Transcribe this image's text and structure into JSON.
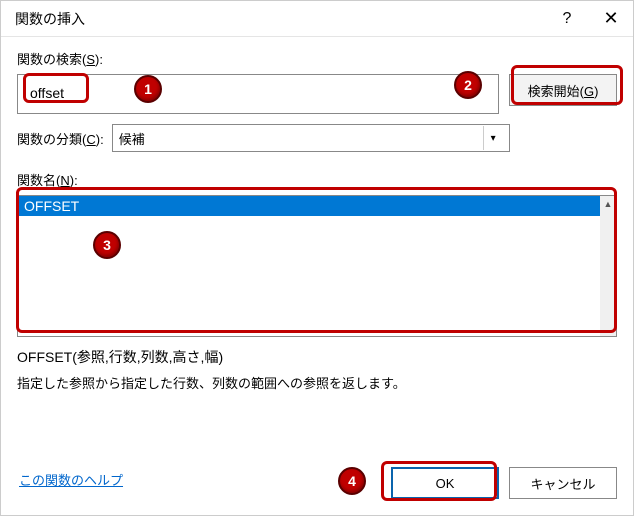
{
  "dialog": {
    "title": "関数の挿入",
    "help_icon": "?",
    "close_icon": "✕"
  },
  "search": {
    "label_prefix": "関数の検索(",
    "label_key": "S",
    "label_suffix": "):",
    "value": "offset",
    "button_prefix": "検索開始(",
    "button_key": "G",
    "button_suffix": ")"
  },
  "category": {
    "label_prefix": "関数の分類(",
    "label_key": "C",
    "label_suffix": "):",
    "selected": "候補"
  },
  "funcname": {
    "label_prefix": "関数名(",
    "label_key": "N",
    "label_suffix": "):"
  },
  "funclist": {
    "items": [
      "OFFSET"
    ]
  },
  "description": {
    "signature": "OFFSET(参照,行数,列数,高さ,幅)",
    "text": "指定した参照から指定した行数、列数の範囲への参照を返します。"
  },
  "help_link": "この関数のヘルプ",
  "footer": {
    "ok": "OK",
    "cancel": "キャンセル"
  },
  "badges": {
    "b1": "1",
    "b2": "2",
    "b3": "3",
    "b4": "4"
  }
}
